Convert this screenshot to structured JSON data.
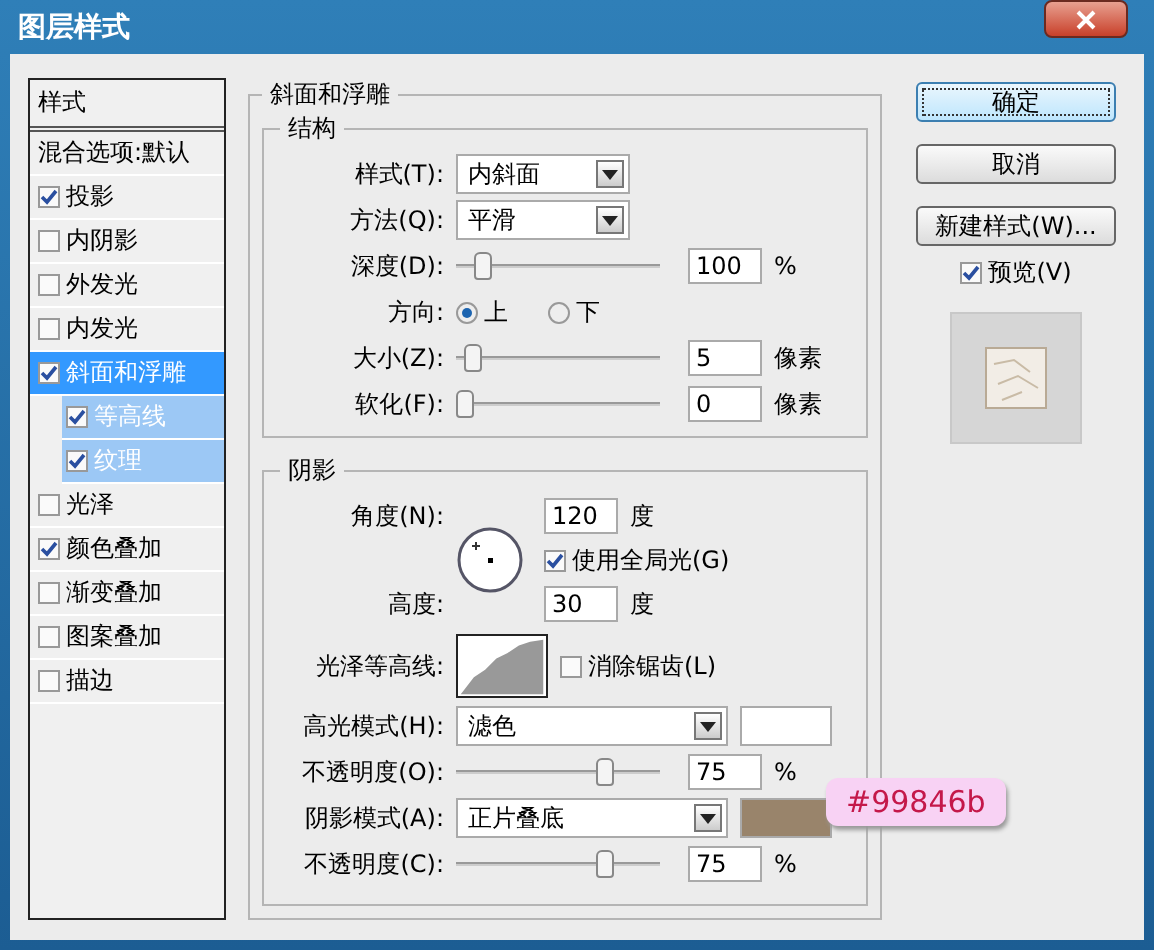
{
  "window": {
    "title": "图层样式"
  },
  "styles_list": {
    "header": "样式",
    "items": [
      {
        "label": "混合选项:默认",
        "kind": "plain",
        "selected": false
      },
      {
        "label": "投影",
        "kind": "check",
        "checked": true,
        "selected": false
      },
      {
        "label": "内阴影",
        "kind": "check",
        "checked": false,
        "selected": false
      },
      {
        "label": "外发光",
        "kind": "check",
        "checked": false,
        "selected": false
      },
      {
        "label": "内发光",
        "kind": "check",
        "checked": false,
        "selected": false
      },
      {
        "label": "斜面和浮雕",
        "kind": "check",
        "checked": true,
        "selected": true,
        "children": [
          {
            "label": "等高线",
            "kind": "check",
            "checked": true
          },
          {
            "label": "纹理",
            "kind": "check",
            "checked": true
          }
        ]
      },
      {
        "label": "光泽",
        "kind": "check",
        "checked": false,
        "selected": false
      },
      {
        "label": "颜色叠加",
        "kind": "check",
        "checked": true,
        "selected": false
      },
      {
        "label": "渐变叠加",
        "kind": "check",
        "checked": false,
        "selected": false
      },
      {
        "label": "图案叠加",
        "kind": "check",
        "checked": false,
        "selected": false
      },
      {
        "label": "描边",
        "kind": "check",
        "checked": false,
        "selected": false
      }
    ]
  },
  "bevel": {
    "title": "斜面和浮雕",
    "structure": {
      "title": "结构",
      "rows": [
        {
          "kind": "dropdown",
          "label": "样式(T):",
          "value": "内斜面"
        },
        {
          "kind": "dropdown",
          "label": "方法(Q):",
          "value": "平滑"
        },
        {
          "kind": "slider",
          "label": "深度(D):",
          "level": 0.1,
          "value": "100",
          "unit": "%"
        },
        {
          "kind": "radio",
          "label": "方向:",
          "options": [
            {
              "label": "上",
              "selected": true
            },
            {
              "label": "下",
              "selected": false
            }
          ]
        },
        {
          "kind": "slider",
          "label": "大小(Z):",
          "level": 0.04,
          "value": "5",
          "unit": "像素"
        },
        {
          "kind": "slider",
          "label": "软化(F):",
          "level": 0,
          "value": "0",
          "unit": "像素"
        }
      ]
    },
    "shading": {
      "title": "阴影",
      "angle": {
        "label": "角度(N):",
        "value": "120",
        "unit": "度"
      },
      "global_light": {
        "label": "使用全局光(G)",
        "checked": true
      },
      "altitude": {
        "label": "高度:",
        "value": "30",
        "unit": "度"
      },
      "gloss_contour": {
        "label": "光泽等高线:",
        "anti_alias": {
          "label": "消除锯齿(L)",
          "checked": false
        }
      },
      "rows": [
        {
          "kind": "mode",
          "label": "高光模式(H):",
          "value": "滤色",
          "color": "#ffffff"
        },
        {
          "kind": "slider",
          "label": "不透明度(O):",
          "level": 0.75,
          "value": "75",
          "unit": "%"
        },
        {
          "kind": "mode",
          "label": "阴影模式(A):",
          "value": "正片叠底",
          "color": "#99846b"
        },
        {
          "kind": "slider",
          "label": "不透明度(C):",
          "level": 0.75,
          "value": "75",
          "unit": "%"
        }
      ]
    }
  },
  "buttons": [
    {
      "label": "确定",
      "default": true
    },
    {
      "label": "取消",
      "default": false
    },
    {
      "label": "新建样式(W)...",
      "default": false
    }
  ],
  "preview": {
    "label": "预览(V)",
    "checked": true
  },
  "annotation": {
    "text": "#99846b"
  }
}
